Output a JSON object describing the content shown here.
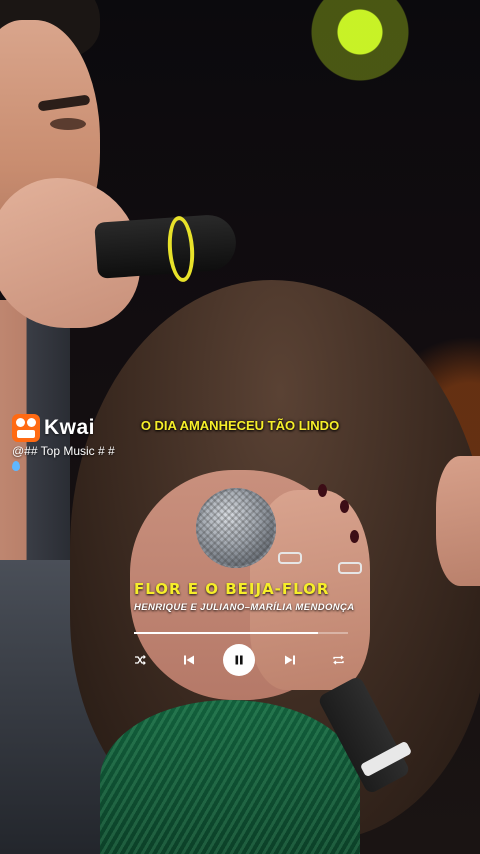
{
  "app": {
    "brand": "Kwai",
    "username": "@## Top Music # #",
    "brand_color": "#ff6a13"
  },
  "video_overlay": {
    "lyric_line": "O DIA AMANHECEU TÃO LINDO",
    "song_title": "FLOR E O BEIJA-FLOR",
    "artists": "HENRIQUE E JULIANO–MARÍLIA MENDONÇA",
    "lyric_color": "#f6ee2a",
    "progress": 0.86
  },
  "player_controls": {
    "shuffle_icon": "shuffle-icon",
    "previous_icon": "skip-previous-icon",
    "pause_icon": "pause-icon",
    "next_icon": "skip-next-icon",
    "repeat_icon": "repeat-icon"
  }
}
